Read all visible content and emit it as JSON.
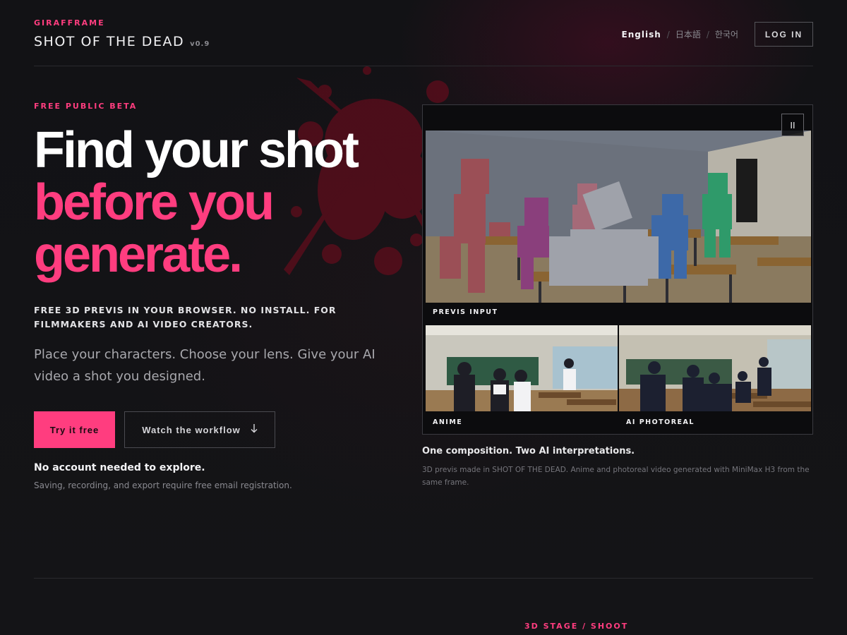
{
  "brand": {
    "small": "GIRAFFRAME",
    "title": "SHOT OF THE DEAD",
    "version": "v0.9"
  },
  "nav": {
    "languages": [
      {
        "label": "English",
        "active": true
      },
      {
        "label": "日本語",
        "active": false
      },
      {
        "label": "한국어",
        "active": false
      }
    ],
    "separator": "/",
    "login": "LOG IN"
  },
  "hero": {
    "badge": "FREE PUBLIC BETA",
    "headline_line1": "Find your shot",
    "headline_line2": "before you",
    "headline_line3": "generate.",
    "tagline": "FREE 3D PREVIS IN YOUR BROWSER. NO INSTALL. FOR FILMMAKERS AND AI VIDEO CREATORS.",
    "lead": "Place your characters. Choose your lens. Give your AI video a shot you designed.",
    "primary_cta": "Try it free",
    "secondary_cta": "Watch the workflow",
    "secondary_cta_icon": "arrow-down-icon",
    "no_account": "No account needed to explore.",
    "saving_note": "Saving, recording, and export require free email registration."
  },
  "showcase": {
    "pause_icon": "pause-icon",
    "pause_glyph": "II",
    "previs_label": "PREVIS INPUT",
    "anime_label": "ANIME",
    "photoreal_label": "AI PHOTOREAL",
    "caption_title": "One composition. Two AI interpretations.",
    "caption_text": "3D previs made in SHOT OF THE DEAD. Anime and photoreal video generated with MiniMax H3 from the same frame."
  },
  "next_section": {
    "label": "3D STAGE / SHOOT"
  },
  "colors": {
    "accent": "#ff3d7f",
    "background": "#111114",
    "text": "#e8e8ea",
    "muted": "#8a8a90"
  }
}
